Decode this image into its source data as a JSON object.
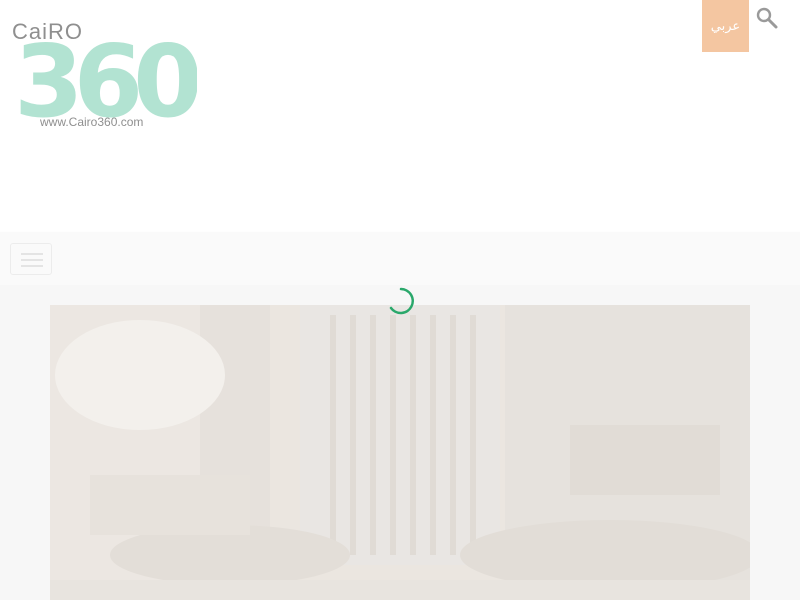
{
  "logo": {
    "word": "CaiRO",
    "digits": "360",
    "url": "www.Cairo360.com"
  },
  "header": {
    "language_label": "عربي"
  },
  "icons": {
    "search": "search-icon",
    "menu": "hamburger-menu-icon",
    "loading": "loading-spinner-icon"
  },
  "colors": {
    "language_button": "#f4c6a1",
    "logo_teal": "#7fd0d6",
    "logo_green": "#b5e4a0",
    "spinner": "#2aa86b"
  }
}
